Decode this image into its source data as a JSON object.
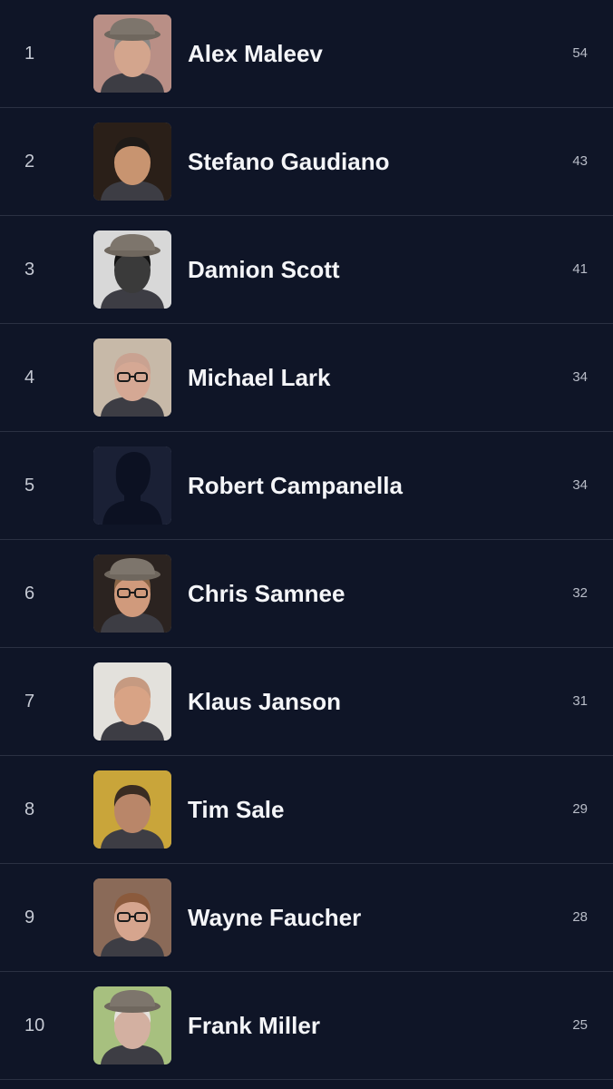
{
  "artists": [
    {
      "rank": "1",
      "name": "Alex Maleev",
      "count": "54",
      "avatar": "photo",
      "bg": "#b98f86",
      "skin": "#d3a58d",
      "hair": "#8a8784",
      "hat": true,
      "glasses": false
    },
    {
      "rank": "2",
      "name": "Stefano Gaudiano",
      "count": "43",
      "avatar": "photo",
      "bg": "#2a1f18",
      "skin": "#c89470",
      "hair": "#1e1a17",
      "hat": false,
      "glasses": false
    },
    {
      "rank": "3",
      "name": "Damion Scott",
      "count": "41",
      "avatar": "photo",
      "bg": "#d8d8d8",
      "skin": "#3a3a3a",
      "hair": "#111111",
      "hat": true,
      "glasses": false
    },
    {
      "rank": "4",
      "name": "Michael Lark",
      "count": "34",
      "avatar": "photo",
      "bg": "#c7b9a8",
      "skin": "#d5a894",
      "hair": "#c9a291",
      "hat": false,
      "glasses": true
    },
    {
      "rank": "5",
      "name": "Robert Campanella",
      "count": "34",
      "avatar": "placeholder",
      "bg": "#1a2035",
      "skin": "#0c1122",
      "hair": "#0c1122",
      "hat": false,
      "glasses": false
    },
    {
      "rank": "6",
      "name": "Chris Samnee",
      "count": "32",
      "avatar": "photo",
      "bg": "#2b2320",
      "skin": "#d09a7c",
      "hair": "#8a6546",
      "hat": true,
      "glasses": true
    },
    {
      "rank": "7",
      "name": "Klaus Janson",
      "count": "31",
      "avatar": "photo",
      "bg": "#e3e1dc",
      "skin": "#d8a385",
      "hair": "#c69a81",
      "hat": false,
      "glasses": false
    },
    {
      "rank": "8",
      "name": "Tim Sale",
      "count": "29",
      "avatar": "photo",
      "bg": "#c9a53a",
      "skin": "#b98669",
      "hair": "#3a2c22",
      "hat": false,
      "glasses": false
    },
    {
      "rank": "9",
      "name": "Wayne Faucher",
      "count": "28",
      "avatar": "photo",
      "bg": "#8a6a58",
      "skin": "#d6a58e",
      "hair": "#8b5a3c",
      "hat": false,
      "glasses": true
    },
    {
      "rank": "10",
      "name": "Frank Miller",
      "count": "25",
      "avatar": "photo",
      "bg": "#a7c07f",
      "skin": "#d3b0a1",
      "hair": "#e6e2dc",
      "hat": true,
      "glasses": false
    }
  ]
}
